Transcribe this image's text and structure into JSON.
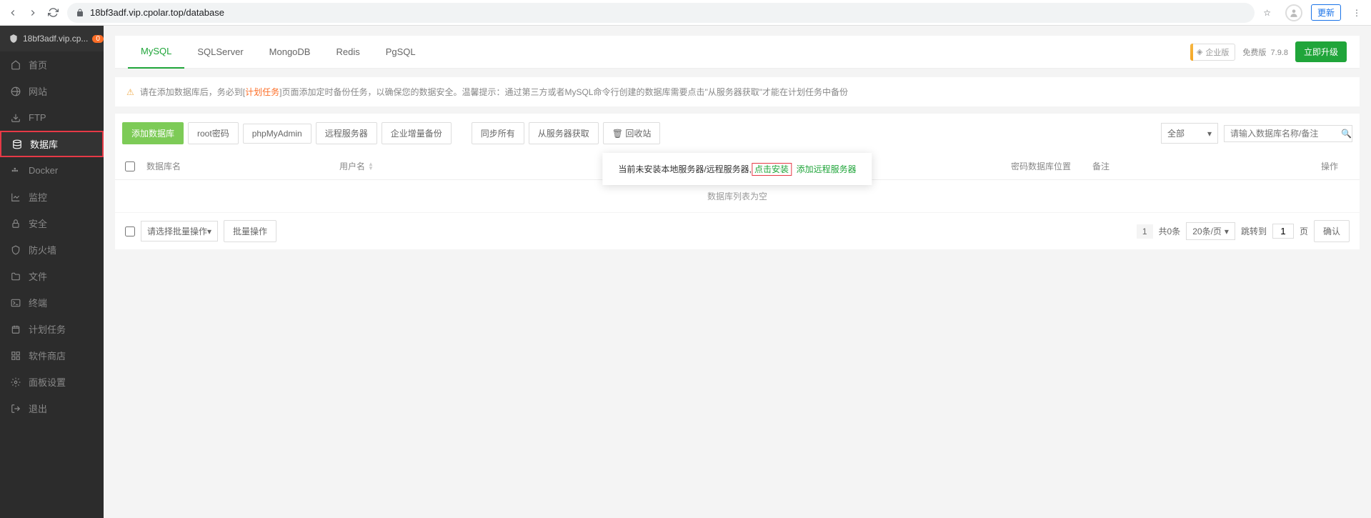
{
  "browser": {
    "url": "18bf3adf.vip.cpolar.top/database",
    "update": "更新"
  },
  "sidebar": {
    "host": "18bf3adf.vip.cp...",
    "badge": "0",
    "items": [
      {
        "label": "首页"
      },
      {
        "label": "网站"
      },
      {
        "label": "FTP"
      },
      {
        "label": "数据库"
      },
      {
        "label": "Docker"
      },
      {
        "label": "监控"
      },
      {
        "label": "安全"
      },
      {
        "label": "防火墙"
      },
      {
        "label": "文件"
      },
      {
        "label": "终端"
      },
      {
        "label": "计划任务"
      },
      {
        "label": "软件商店"
      },
      {
        "label": "面板设置"
      },
      {
        "label": "退出"
      }
    ]
  },
  "tabs": {
    "items": [
      {
        "label": "MySQL"
      },
      {
        "label": "SQLServer"
      },
      {
        "label": "MongoDB"
      },
      {
        "label": "Redis"
      },
      {
        "label": "PgSQL"
      }
    ],
    "enterprise": "企业版",
    "free": "免费版",
    "version": "7.9.8",
    "upgrade": "立即升级"
  },
  "alert": {
    "prefix": "请在添加数据库后，务必到[",
    "link": "计划任务",
    "suffix": "]页面添加定时备份任务，以确保您的数据安全。温馨提示：通过第三方或者MySQL命令行创建的数据库需要点击\"从服务器获取\"才能在计划任务中备份"
  },
  "toolbar": {
    "add": "添加数据库",
    "root": "root密码",
    "pma": "phpMyAdmin",
    "remote": "远程服务器",
    "backup": "企业增量备份",
    "sync": "同步所有",
    "fetch": "从服务器获取",
    "trash": "回收站",
    "filter": "全部",
    "search_placeholder": "请输入数据库名称/备注"
  },
  "thead": {
    "name": "数据库名",
    "user": "用户名",
    "pass": "密码",
    "loc": "数据库位置",
    "note": "备注",
    "op": "操作"
  },
  "popup": {
    "t1": "当前未安装本地服务器/远程服务器,",
    "t2": "点击安装",
    "t3": "添加远程服务器"
  },
  "empty": "数据库列表为空",
  "tfoot": {
    "batch_sel": "请选择批量操作",
    "batch_btn": "批量操作",
    "page": "1",
    "total": "共0条",
    "per": "20条/页",
    "jump": "跳转到",
    "jump_val": "1",
    "page_unit": "页",
    "confirm": "确认"
  }
}
